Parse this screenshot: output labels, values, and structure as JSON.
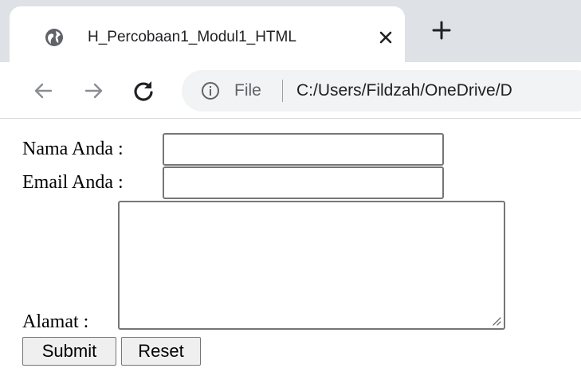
{
  "browser": {
    "tab": {
      "title": "H_Percobaan1_Modul1_HTML",
      "favicon": "globe-icon",
      "close_icon": "close-icon"
    },
    "new_tab_icon": "plus-icon",
    "nav": {
      "back_icon": "arrow-left-icon",
      "forward_icon": "arrow-right-icon",
      "reload_icon": "reload-icon"
    },
    "address_bar": {
      "info_icon": "info-icon",
      "scheme": "File",
      "url": "C:/Users/Fildzah/OneDrive/D"
    }
  },
  "form": {
    "name_label": "Nama Anda :",
    "name_value": "",
    "email_label": "Email Anda :",
    "email_value": "",
    "address_label": "Alamat :",
    "address_value": "",
    "submit_label": "Submit",
    "reset_label": "Reset"
  },
  "colors": {
    "tabstrip_bg": "#dee1e6",
    "omnibox_bg": "#f1f3f4",
    "input_border": "#767676",
    "button_bg": "#efefef"
  }
}
